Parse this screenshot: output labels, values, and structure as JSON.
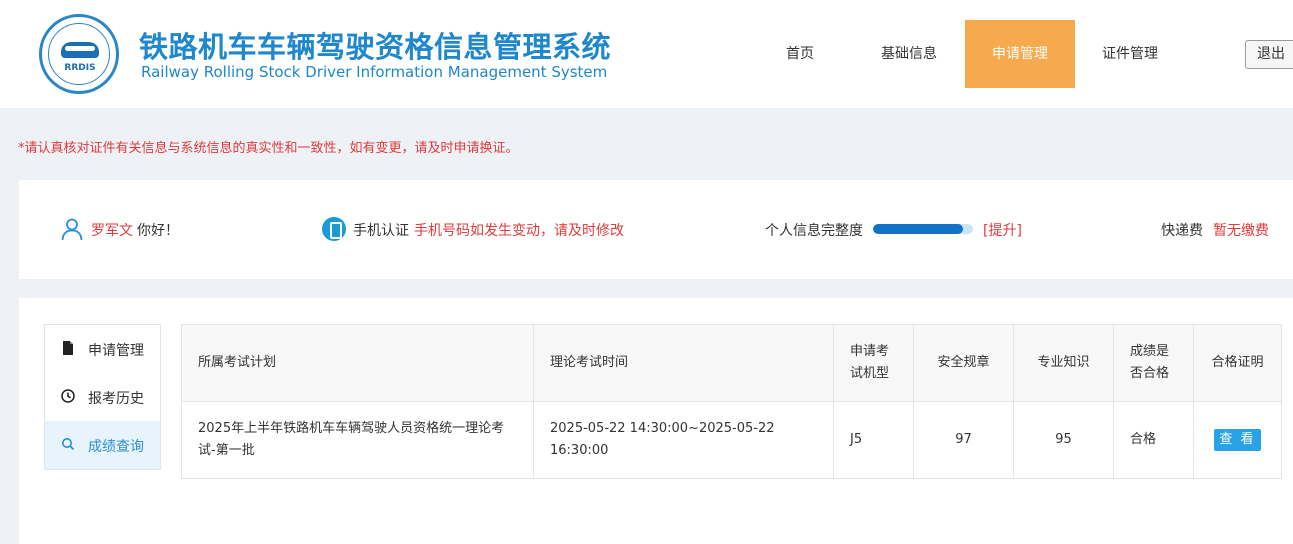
{
  "header": {
    "logo_text": "RRDIS",
    "title_cn": "铁路机车车辆驾驶资格信息管理系统",
    "title_en": "Railway Rolling Stock Driver Information Management System",
    "nav": [
      {
        "label": "首页"
      },
      {
        "label": "基础信息"
      },
      {
        "label": "申请管理"
      },
      {
        "label": "证件管理"
      }
    ],
    "active_nav": "申请管理",
    "logout_label": "退出"
  },
  "notice": "*请认真核对证件有关信息与系统信息的真实性和一致性，如有变更，请及时申请换证。",
  "info_bar": {
    "user_name": "罗军文",
    "greeting": "你好！",
    "phone_label": "手机认证",
    "phone_tip": "手机号码如发生变动，请及时修改",
    "completeness_label": "个人信息完整度",
    "completeness_value": 0.9,
    "improve_label": "[提升]",
    "fee_label": "快递费",
    "fee_value": "暂无缴费"
  },
  "side_menu": {
    "items": [
      {
        "label": "申请管理",
        "icon": "document-icon"
      },
      {
        "label": "报考历史",
        "icon": "clock-icon"
      },
      {
        "label": "成绩查询",
        "icon": "search-icon"
      }
    ],
    "active": "成绩查询"
  },
  "grades_table": {
    "headers": [
      "所属考试计划",
      "理论考试时间",
      "申请考试机型",
      "安全规章",
      "专业知识",
      "成绩是否合格",
      "合格证明"
    ],
    "rows": [
      {
        "plan": "2025年上半年铁路机车车辆驾驶人员资格统一理论考试-第一批",
        "time": "2025-05-22 14:30:00~2025-05-22 16:30:00",
        "model": "J5",
        "safety": "97",
        "knowledge": "95",
        "passed": "合格",
        "action": "查 看"
      }
    ]
  },
  "colors": {
    "brand_blue": "#1f87cc",
    "nav_active": "#f7a94d",
    "alert_red": "#e23a3a",
    "progress": "#1272c6",
    "button": "#2aa3e6"
  }
}
